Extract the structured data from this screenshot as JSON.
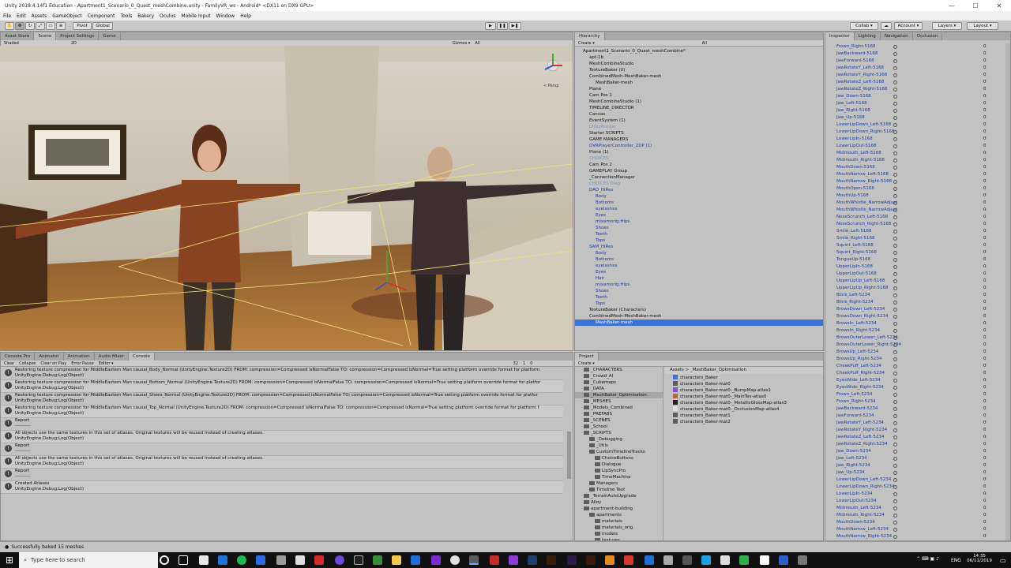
{
  "window": {
    "title": "Unity 2018.4.14f1 Education - Apartment1_Scenario_0_Quest_meshCombine.unity - FamilyVR_ws - Android* <DX11 on DX9 GPU>",
    "controls": [
      "—",
      "☐",
      "✕"
    ]
  },
  "menu": [
    "File",
    "Edit",
    "Assets",
    "GameObject",
    "Component",
    "Tools",
    "Bakery",
    "Oculus",
    "Mobile Input",
    "Window",
    "Help"
  ],
  "toolbar": {
    "pivot": "Pivot",
    "global": "Global",
    "collab": "Collab ▾",
    "account": "Account ▾",
    "layers": "Layers ▾",
    "layout": "Layout ▾"
  },
  "scene": {
    "tabs": [
      "Asset Store",
      "Scene",
      "Project Settings",
      "Game"
    ],
    "active_tab": "Scene",
    "shading": "Shaded",
    "mode2d": "2D",
    "gizmos": "Gizmos ▾",
    "search": "All",
    "persp": "< Persp"
  },
  "hierarchy": {
    "tab": "Hierarchy",
    "create": "Create ▾",
    "search": "All",
    "items": [
      {
        "label": "Apartment1_Scenario_0_Quest_meshCombine*",
        "indent": 0,
        "color": "#111"
      },
      {
        "label": "apt-1b",
        "indent": 1,
        "color": "#111"
      },
      {
        "label": "MeshCombineStudio",
        "indent": 1,
        "color": "#111"
      },
      {
        "label": "TextureBaker (0)",
        "indent": 1,
        "color": "#111"
      },
      {
        "label": "CombinedMesh-MeshBaker-mesh",
        "indent": 1,
        "color": "#111"
      },
      {
        "label": "MeshBaker-mesh",
        "indent": 2,
        "color": "#111"
      },
      {
        "label": "Plane",
        "indent": 1,
        "color": "#111"
      },
      {
        "label": "Cam Pos 1",
        "indent": 1,
        "color": "#111"
      },
      {
        "label": "MeshCombineStudio (1)",
        "indent": 1,
        "color": "#111"
      },
      {
        "label": "TIMELINE_DIRECTOR",
        "indent": 1,
        "color": "#111"
      },
      {
        "label": "Canvas",
        "indent": 1,
        "color": "#111"
      },
      {
        "label": "EventSystem (1)",
        "indent": 1,
        "color": "#111"
      },
      {
        "label": "UIGizPointer",
        "indent": 1,
        "color": "#7a8fb8"
      },
      {
        "label": "Starter SCRIPTS",
        "indent": 1,
        "color": "#111"
      },
      {
        "label": "GAME MANAGERS",
        "indent": 1,
        "color": "#111"
      },
      {
        "label": "OVRPlayerController_2DP (1)",
        "indent": 1,
        "color": "#1a3da0"
      },
      {
        "label": "Plane (1)",
        "indent": 1,
        "color": "#111"
      },
      {
        "label": "CHOICES",
        "indent": 1,
        "color": "#7a8fb8"
      },
      {
        "label": "Cam Pos 2",
        "indent": 1,
        "color": "#111"
      },
      {
        "label": "GAMEPLAY Group",
        "indent": 1,
        "color": "#111"
      },
      {
        "label": "_ConnectionManager",
        "indent": 1,
        "color": "#111"
      },
      {
        "label": "CHOICES Diag",
        "indent": 1,
        "color": "#7a8fb8"
      },
      {
        "label": "DAD_HiRes",
        "indent": 1,
        "color": "#1a3da0"
      },
      {
        "label": "Body",
        "indent": 2,
        "color": "#1a3da0"
      },
      {
        "label": "Bottoms",
        "indent": 2,
        "color": "#1a3da0"
      },
      {
        "label": "eyelashes",
        "indent": 2,
        "color": "#1a3da0"
      },
      {
        "label": "Eyes",
        "indent": 2,
        "color": "#1a3da0"
      },
      {
        "label": "mixamorig:Hips",
        "indent": 2,
        "color": "#1a3da0"
      },
      {
        "label": "Shoes",
        "indent": 2,
        "color": "#1a3da0"
      },
      {
        "label": "Teeth",
        "indent": 2,
        "color": "#1a3da0"
      },
      {
        "label": "Tops",
        "indent": 2,
        "color": "#1a3da0"
      },
      {
        "label": "SAM_HiRes",
        "indent": 1,
        "color": "#1a3da0"
      },
      {
        "label": "Body",
        "indent": 2,
        "color": "#1a3da0"
      },
      {
        "label": "Bottoms",
        "indent": 2,
        "color": "#1a3da0"
      },
      {
        "label": "eyelashes",
        "indent": 2,
        "color": "#1a3da0"
      },
      {
        "label": "Eyes",
        "indent": 2,
        "color": "#1a3da0"
      },
      {
        "label": "Hair",
        "indent": 2,
        "color": "#1a3da0"
      },
      {
        "label": "mixamorig:Hips",
        "indent": 2,
        "color": "#1a3da0"
      },
      {
        "label": "Shoes",
        "indent": 2,
        "color": "#1a3da0"
      },
      {
        "label": "Teeth",
        "indent": 2,
        "color": "#1a3da0"
      },
      {
        "label": "Tops",
        "indent": 2,
        "color": "#1a3da0"
      },
      {
        "label": "TextureBaker (Characters)",
        "indent": 1,
        "color": "#111"
      },
      {
        "label": "CombinedMesh-MeshBaker-mesh",
        "indent": 1,
        "color": "#111"
      },
      {
        "label": "MeshBaker-mesh",
        "indent": 2,
        "color": "#fff",
        "selected": true
      }
    ]
  },
  "console": {
    "tabs": [
      "Console Pro",
      "Animator",
      "Animation",
      "Audio Mixer",
      "Console"
    ],
    "active_tab": "Console",
    "buttons": [
      "Clear",
      "Collapse",
      "Clear on Play",
      "Error Pause",
      "Editor ▾"
    ],
    "counts": [
      "32",
      "1",
      "0"
    ],
    "rows": [
      {
        "line1": "Restoring texture compression for MiddleEastern Man causal_Body_Normal (UnityEngine.Texture2D)  FROM: compression=Compressed isNormalFalse TO: compression=Compressed isNormal=True  setting platform override format for platform",
        "line2": "UnityEngine.Debug:Log(Object)"
      },
      {
        "line1": "Restoring texture compression for MiddleEastern Man causal_Bottom_Normal (UnityEngine.Texture2D)  FROM: compression=Compressed isNormalFalse TO: compression=Compressed isNormal=True  setting platform override format for platfor",
        "line2": "UnityEngine.Debug:Log(Object)"
      },
      {
        "line1": "Restoring texture compression for MiddleEastern Man causal_Shoes_Normal (UnityEngine.Texture2D)  FROM: compression=Compressed isNormalFalse TO: compression=Compressed isNormal=True  setting platform override format for platfor",
        "line2": "UnityEngine.Debug:Log(Object)"
      },
      {
        "line1": "Restoring texture compression for MiddleEastern Man causal_Top_Normal (UnityEngine.Texture2D)  FROM: compression=Compressed isNormalFalse TO: compression=Compressed isNormal=True  setting platform override format for platform f",
        "line2": "UnityEngine.Debug:Log(Object)"
      },
      {
        "line1": "Report",
        "line2": "----------"
      },
      {
        "line1": "All objects use the same textures in this set of atlases. Original textures will be reused instead of creating atlases.",
        "line2": "UnityEngine.Debug:Log(Object)"
      },
      {
        "line1": "Report",
        "line2": "----------"
      },
      {
        "line1": "All objects use the same textures in this set of atlases. Original textures will be reused instead of creating atlases.",
        "line2": "UnityEngine.Debug:Log(Object)"
      },
      {
        "line1": "Report",
        "line2": "----------"
      },
      {
        "line1": "Created Atlases",
        "line2": "UnityEngine.Debug:Log(Object)"
      }
    ]
  },
  "project": {
    "tab": "Project",
    "create": "Create ▾",
    "breadcrumb": "Assets > _MeshBaker_Optimisation",
    "folders": [
      {
        "label": "_CHARACTERS",
        "indent": 1
      },
      {
        "label": "_Crowd_AI",
        "indent": 1
      },
      {
        "label": "_Cubemaps",
        "indent": 1
      },
      {
        "label": "_DATA",
        "indent": 1
      },
      {
        "label": "_MeshBaker_Optimisation",
        "indent": 1,
        "selected": true
      },
      {
        "label": "_MESHES",
        "indent": 1
      },
      {
        "label": "_Models_Combined",
        "indent": 1
      },
      {
        "label": "_PREFABS",
        "indent": 1
      },
      {
        "label": "_SCENES",
        "indent": 1
      },
      {
        "label": "_School",
        "indent": 1
      },
      {
        "label": "_SCRIPTS",
        "indent": 1
      },
      {
        "label": "_Debugging",
        "indent": 2
      },
      {
        "label": "_Utils",
        "indent": 2
      },
      {
        "label": "CustomTimelineTracks",
        "indent": 2
      },
      {
        "label": "ChoiceButtons",
        "indent": 3
      },
      {
        "label": "Dialogue",
        "indent": 3
      },
      {
        "label": "LipSyncPro",
        "indent": 3
      },
      {
        "label": "TimeMachine",
        "indent": 3
      },
      {
        "label": "Managers",
        "indent": 2
      },
      {
        "label": "Timeline Text",
        "indent": 2
      },
      {
        "label": "_TerrainAutoUpgrade",
        "indent": 1
      },
      {
        "label": "Alloy",
        "indent": 1
      },
      {
        "label": "apartment-building",
        "indent": 1
      },
      {
        "label": "apartments",
        "indent": 2
      },
      {
        "label": "materials",
        "indent": 3
      },
      {
        "label": "materials_orig",
        "indent": 3
      },
      {
        "label": "models",
        "indent": 3
      },
      {
        "label": "textures",
        "indent": 3
      }
    ],
    "assets": [
      {
        "label": "characters_Baker",
        "icon": "#3a72d8"
      },
      {
        "label": "characters_Baker-mat0",
        "icon": "#5b5b5b"
      },
      {
        "label": "characters_Baker-mat0-_BumpMap-atlas1",
        "icon": "#8a4fd0"
      },
      {
        "label": "characters_Baker-mat0-_MainTex-atlas0",
        "icon": "#b06a3a"
      },
      {
        "label": "characters_Baker-mat0-_MetallicGlossMap-atlas3",
        "icon": "#222"
      },
      {
        "label": "characters_Baker-mat0-_OcclusionMap-atlas4",
        "icon": "#ddd"
      },
      {
        "label": "characters_Baker-mat1",
        "icon": "#5b5b5b"
      },
      {
        "label": "characters_Baker-mat2",
        "icon": "#5b5b5b"
      }
    ]
  },
  "inspector": {
    "tabs": [
      "Inspector",
      "Lighting",
      "Navigation",
      "Occlusion"
    ],
    "rows": [
      "Frown_Right-5168",
      "JawBackward-5168",
      "JawForward-5168",
      "JawRotateY_Left-5168",
      "JawRotateY_Right-5168",
      "JawRotateZ_Left-5168",
      "JawRotateZ_Right-5168",
      "Jaw_Down-5168",
      "Jaw_Left-5168",
      "Jaw_Right-5168",
      "Jaw_Up-5168",
      "LowerLipDown_Left-5168",
      "LowerLipDown_Right-5168",
      "LowerLipIn-5168",
      "LowerLipOut-5168",
      "Midmouth_Left-5168",
      "Midmouth_Right-5168",
      "MouthDown-5168",
      "MouthNarrow_Left-5168",
      "MouthNarrow_Right-5168",
      "MouthOpen-5168",
      "MouthUp-5168",
      "MouthWhistle_NarrowAdjust",
      "MouthWhistle_NarrowAdjust",
      "NoseScrunch_Left-5168",
      "NoseScrunch_Right-5168",
      "Smile_Left-5168",
      "Smile_Right-5168",
      "Squint_Left-5168",
      "Squint_Right-5168",
      "TongueUp-5168",
      "UpperLipIn-5168",
      "UpperLipOut-5168",
      "UpperLipUp_Left-5168",
      "UpperLipUp_Right-5168",
      "Blink_Left-5234",
      "Blink_Right-5234",
      "BrowsDown_Left-5234",
      "BrowsDown_Right-5234",
      "BrowsIn_Left-5234",
      "BrowsIn_Right-5234",
      "BrowsOuterLower_Left-5234",
      "BrowsOuterLower_Right-5234",
      "BrowsUp_Left-5234",
      "BrowsUp_Right-5234",
      "CheekPuff_Left-5234",
      "CheekPuff_Right-5234",
      "EyesWide_Left-5234",
      "EyesWide_Right-5234",
      "Frown_Left-5234",
      "Frown_Right-5234",
      "JawBackward-5234",
      "JawForward-5234",
      "JawRotateY_Left-5234",
      "JawRotateY_Right-5234",
      "JawRotateZ_Left-5234",
      "JawRotateZ_Right-5234",
      "Jaw_Down-5234",
      "Jaw_Left-5234",
      "Jaw_Right-5234",
      "Jaw_Up-5234",
      "LowerLipDown_Left-5234",
      "LowerLipDown_Right-5234",
      "LowerLipIn-5234",
      "LowerLipOut-5234",
      "Midmouth_Left-5234",
      "Midmouth_Right-5234",
      "MouthDown-5234",
      "MouthNarrow_Left-5234",
      "MouthNarrow_Right-5234"
    ],
    "value": "0"
  },
  "status": {
    "message": "Successfully baked 15 meshes"
  },
  "taskbar": {
    "search_placeholder": "Type here to search",
    "lang": "ENG",
    "time": "14:35",
    "date": "06/11/2019"
  }
}
